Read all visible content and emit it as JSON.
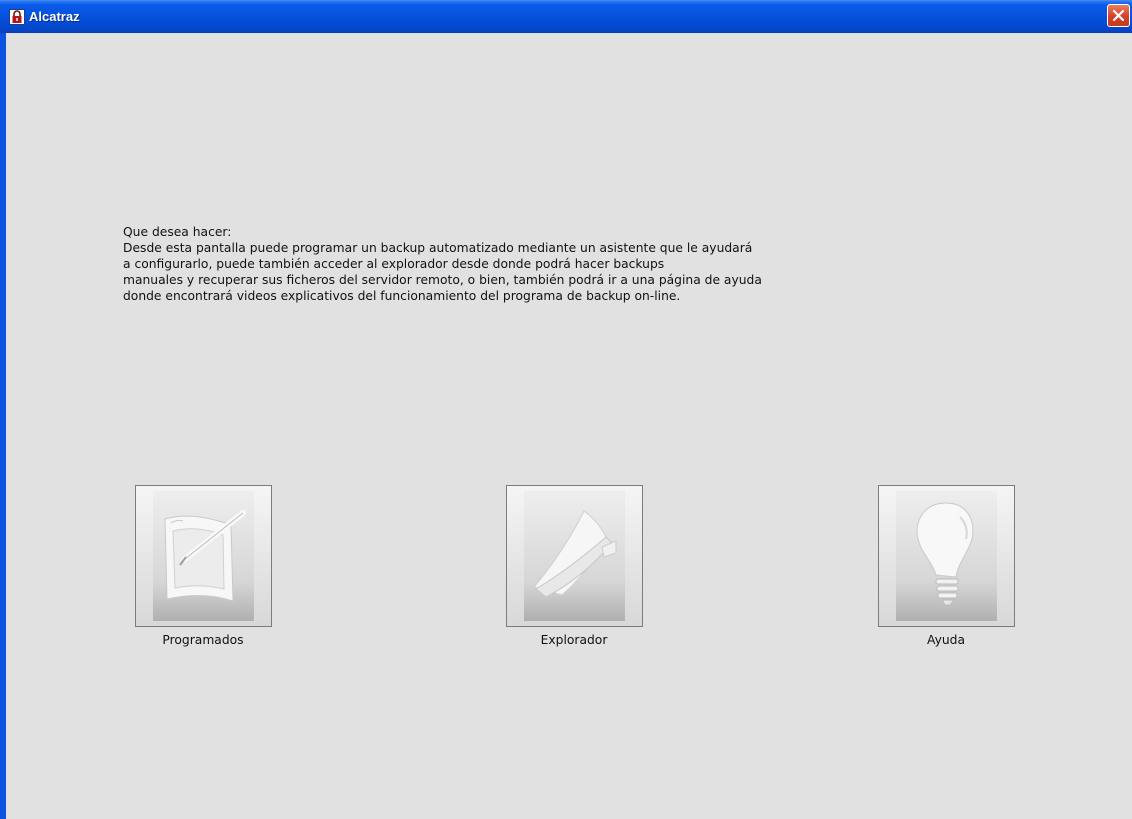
{
  "window": {
    "title": "Alcatraz",
    "icon": "padlock-icon",
    "close_icon": "close-icon"
  },
  "description": {
    "lines": [
      "Que desea hacer:",
      "Desde esta pantalla puede programar un backup automatizado mediante un asistente que le ayudará",
      "a configurarlo, puede también acceder al explorador desde donde podrá hacer backups",
      "manuales y recuperar sus ficheros del servidor remoto, o bien, también podrá ir a una página de ayuda",
      "donde encontrará videos explicativos del funcionamiento del programa de backup on-line."
    ]
  },
  "actions": [
    {
      "label": "Programados",
      "icon": "tablet-pen-icon"
    },
    {
      "label": "Explorador",
      "icon": "folder-icon"
    },
    {
      "label": "Ayuda",
      "icon": "lightbulb-icon"
    }
  ],
  "colors": {
    "titlebar": "#0552dd",
    "client_background": "#e1e1e1",
    "close_button": "#d8432a"
  }
}
